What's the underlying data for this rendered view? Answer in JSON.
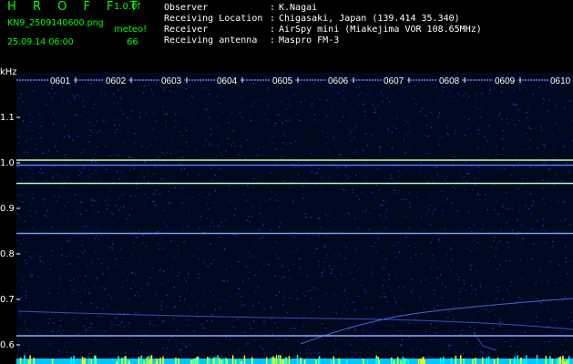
{
  "header": {
    "app_title": "H R O F F T",
    "version": "1.0.0f",
    "filename": "KN9_2509140600.png",
    "meteo_label": "meteo!",
    "datetime": "25.09.14 06:00",
    "count": "66"
  },
  "station_info": [
    {
      "label": "Observer",
      "value": "K.Nagai"
    },
    {
      "label": "Receiving Location",
      "value": "Chigasaki, Japan (139.414 35.340)"
    },
    {
      "label": "Receiver",
      "value": "AirSpy mini (Miakejima VOR 108.65MHz)"
    },
    {
      "label": "Receiving antenna",
      "value": "Maspro FM-3"
    }
  ],
  "separator": ":",
  "colors": {
    "header_green": "#00ff00",
    "background": "#000000",
    "noise_blue": "#1a2a9a",
    "echo_cyan": "#a8ffd8",
    "vertical_marks": "#ffff00",
    "bottom_band": "#00ffff"
  },
  "chart_data": {
    "type": "heatmap",
    "yunit": "kHz",
    "time_labels": [
      "0601",
      "0602",
      "0603",
      "0604",
      "0605",
      "0606",
      "0607",
      "0608",
      "0609",
      "0610"
    ],
    "y_ticks": [
      {
        "value": 1.1,
        "label": "1.1"
      },
      {
        "value": 1.0,
        "label": "1.0"
      },
      {
        "value": 0.9,
        "label": "0.9"
      },
      {
        "value": 0.8,
        "label": "0.8"
      },
      {
        "value": 0.7,
        "label": "0.7"
      },
      {
        "value": 0.6,
        "label": "0.6"
      }
    ],
    "ylim": [
      0.59,
      1.185
    ],
    "horizontal_lines": [
      {
        "freq": 1.006,
        "color": "#c8ffb0"
      },
      {
        "freq": 0.995,
        "color": "#4a7cff"
      },
      {
        "freq": 0.955,
        "color": "#a8ffb8"
      },
      {
        "freq": 0.845,
        "color": "#6aa0ff"
      },
      {
        "freq": 0.62,
        "color": "#8ab0ff"
      }
    ]
  }
}
